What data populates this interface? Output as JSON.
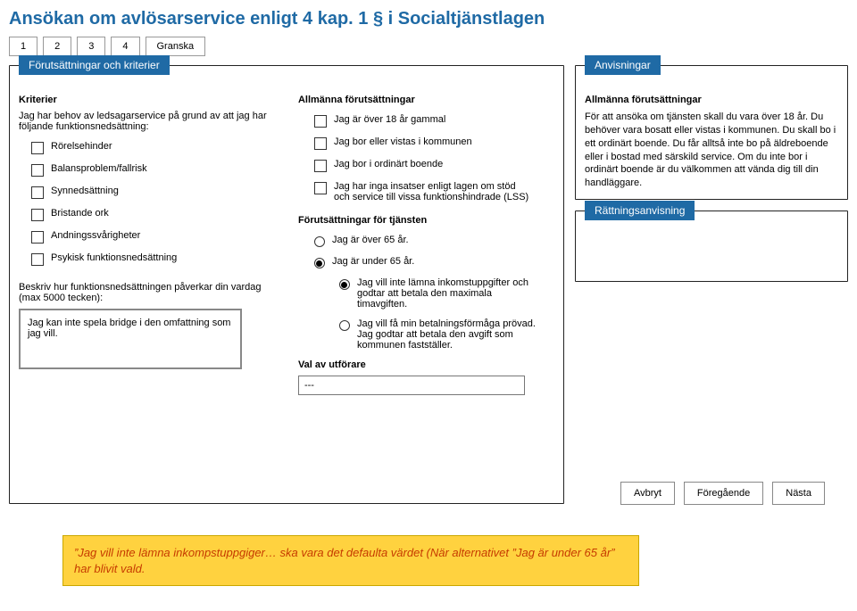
{
  "title": "Ansökan om avlösarservice enligt 4 kap. 1 § i Socialtjänstlagen",
  "tabs": [
    "1",
    "2",
    "3",
    "4",
    "Granska"
  ],
  "left_panel": {
    "header": "Förutsättningar och kriterier",
    "kriterier_heading": "Kriterier",
    "kriterier_intro": "Jag har behov av ledsagarservice på grund av att jag har följande funktionsnedsättning:",
    "criteria": [
      "Rörelsehinder",
      "Balansproblem/fallrisk",
      "Synnedsättning",
      "Bristande ork",
      "Andningssvårigheter",
      "Psykisk funktionsnedsättning"
    ],
    "describe_label": "Beskriv hur funktionsnedsättningen påverkar din vardag (max 5000 tecken):",
    "describe_value": "Jag kan inte spela bridge i den omfattning som jag vill."
  },
  "mid": {
    "general_heading": "Allmänna förutsättningar",
    "general_items": [
      "Jag är över 18 år gammal",
      "Jag bor eller vistas i kommunen",
      "Jag bor i ordinärt boende",
      "Jag har inga insatser enligt lagen om stöd och service till vissa funktionshindrade (LSS)"
    ],
    "service_heading": "Förutsättningar för tjänsten",
    "over65": "Jag är över 65 år.",
    "under65": "Jag är under 65 år.",
    "opt1": "Jag vill inte lämna inkomstuppgifter och godtar att betala den maximala timavgiften.",
    "opt2": "Jag vill få min betalningsförmåga prövad. Jag godtar att betala den avgift som kommunen fastställer.",
    "provider_heading": "Val av utförare",
    "provider_value": "---"
  },
  "right": {
    "anvis_header": "Anvisningar",
    "anvis_title": "Allmänna förutsättningar",
    "anvis_body": "För att ansöka om tjänsten skall du vara över 18 år. Du behöver vara bosatt eller vistas i kommunen. Du skall bo i ett ordinärt boende. Du får alltså inte bo på äldreboende eller i bostad med särskild service. Om du inte bor i ordinärt boende är du välkommen att vända dig till din handläggare.",
    "rattning_header": "Rättningsanvisning"
  },
  "buttons": {
    "cancel": "Avbryt",
    "prev": "Föregående",
    "next": "Nästa"
  },
  "callout": "”Jag vill inte lämna inkompstuppgiger… ska vara det defaulta värdet (När alternativet ”Jag är under 65 år” har blivit vald."
}
